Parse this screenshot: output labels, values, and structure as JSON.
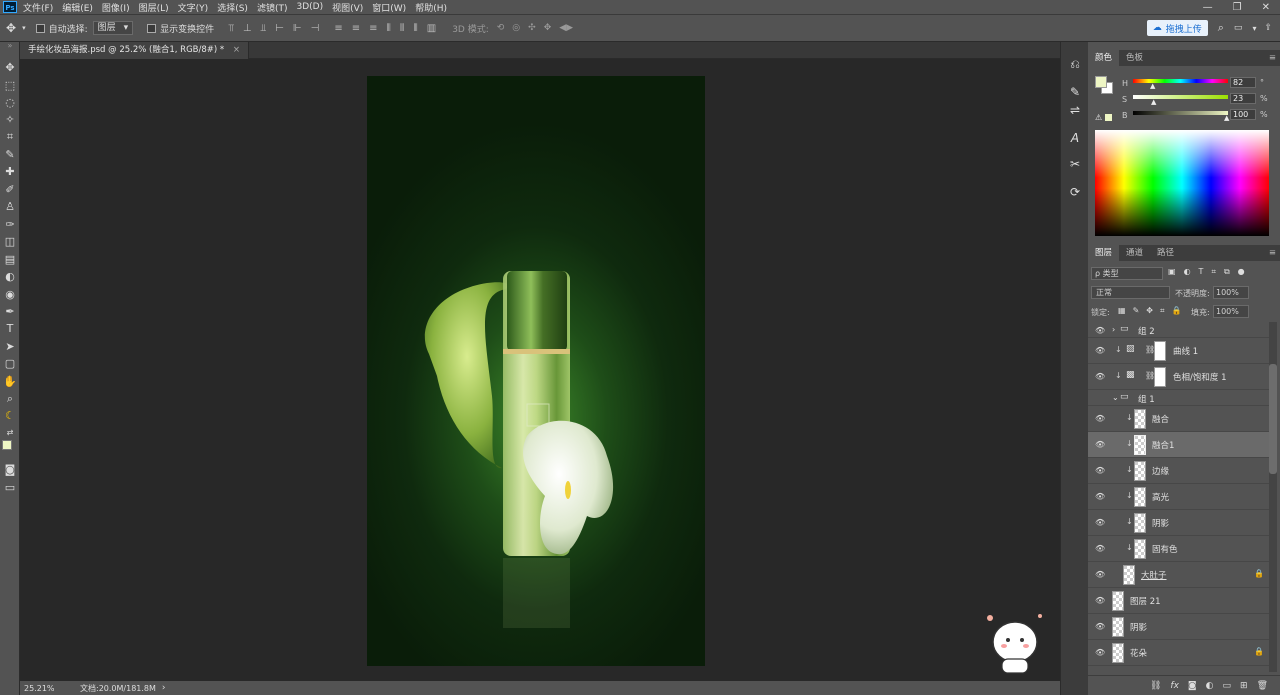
{
  "app": {
    "logo": "Ps"
  },
  "menu": [
    "文件(F)",
    "编辑(E)",
    "图像(I)",
    "图层(L)",
    "文字(Y)",
    "选择(S)",
    "滤镜(T)",
    "3D(D)",
    "视图(V)",
    "窗口(W)",
    "帮助(H)"
  ],
  "window_controls": {
    "minimize": "—",
    "maximize": "❐",
    "close": "✕"
  },
  "options": {
    "auto_select_label": "自动选择:",
    "auto_select_value": "图层",
    "show_transform_label": "显示变换控件",
    "mode_3d_label": "3D 模式:",
    "upload_label": "拖拽上传"
  },
  "document": {
    "tab_title": "手绘化妆品海报.psd @ 25.2% (融合1, RGB/8#) *",
    "close": "×"
  },
  "status": {
    "zoom": "25.21%",
    "doc_info": "文档:20.0M/181.8M"
  },
  "color_panel": {
    "tabs": [
      "颜色",
      "色板"
    ],
    "active_tab": 0,
    "h_label": "H",
    "h_value": "82",
    "h_unit": "°",
    "s_label": "S",
    "s_value": "23",
    "s_unit": "%",
    "b_label": "B",
    "b_value": "100",
    "b_unit": "%",
    "foreground": "#eef6c4",
    "background": "#ffffff"
  },
  "layers_panel": {
    "tabs": [
      "图层",
      "通道",
      "路径"
    ],
    "active_tab": 0,
    "filter_label": "ρ 类型",
    "blend_mode": "正常",
    "opacity_label": "不透明度:",
    "opacity_value": "100%",
    "lock_label": "锁定:",
    "fill_label": "填充:",
    "fill_value": "100%",
    "layers": [
      {
        "name": "组 2",
        "kind": "group",
        "expanded": false
      },
      {
        "name": "曲线 1",
        "kind": "adjustment"
      },
      {
        "name": "色相/饱和度 1",
        "kind": "adjustment"
      },
      {
        "name": "组 1",
        "kind": "group",
        "expanded": true
      },
      {
        "name": "融合",
        "kind": "clipped"
      },
      {
        "name": "融合1",
        "kind": "clipped",
        "selected": true
      },
      {
        "name": "边缘",
        "kind": "clipped"
      },
      {
        "name": "高光",
        "kind": "clipped"
      },
      {
        "name": "阴影",
        "kind": "clipped"
      },
      {
        "name": "固有色",
        "kind": "clipped"
      },
      {
        "name": "大肚子",
        "kind": "pixel",
        "locked": true
      },
      {
        "name": "图层 21",
        "kind": "pixel"
      },
      {
        "name": "阴影",
        "kind": "pixel"
      },
      {
        "name": "花朵",
        "kind": "pixel",
        "locked": true
      }
    ],
    "footer_icons": [
      "link-icon",
      "fx-icon",
      "mask-icon",
      "adjustment-icon",
      "folder-icon",
      "new-layer-icon",
      "trash-icon"
    ]
  }
}
